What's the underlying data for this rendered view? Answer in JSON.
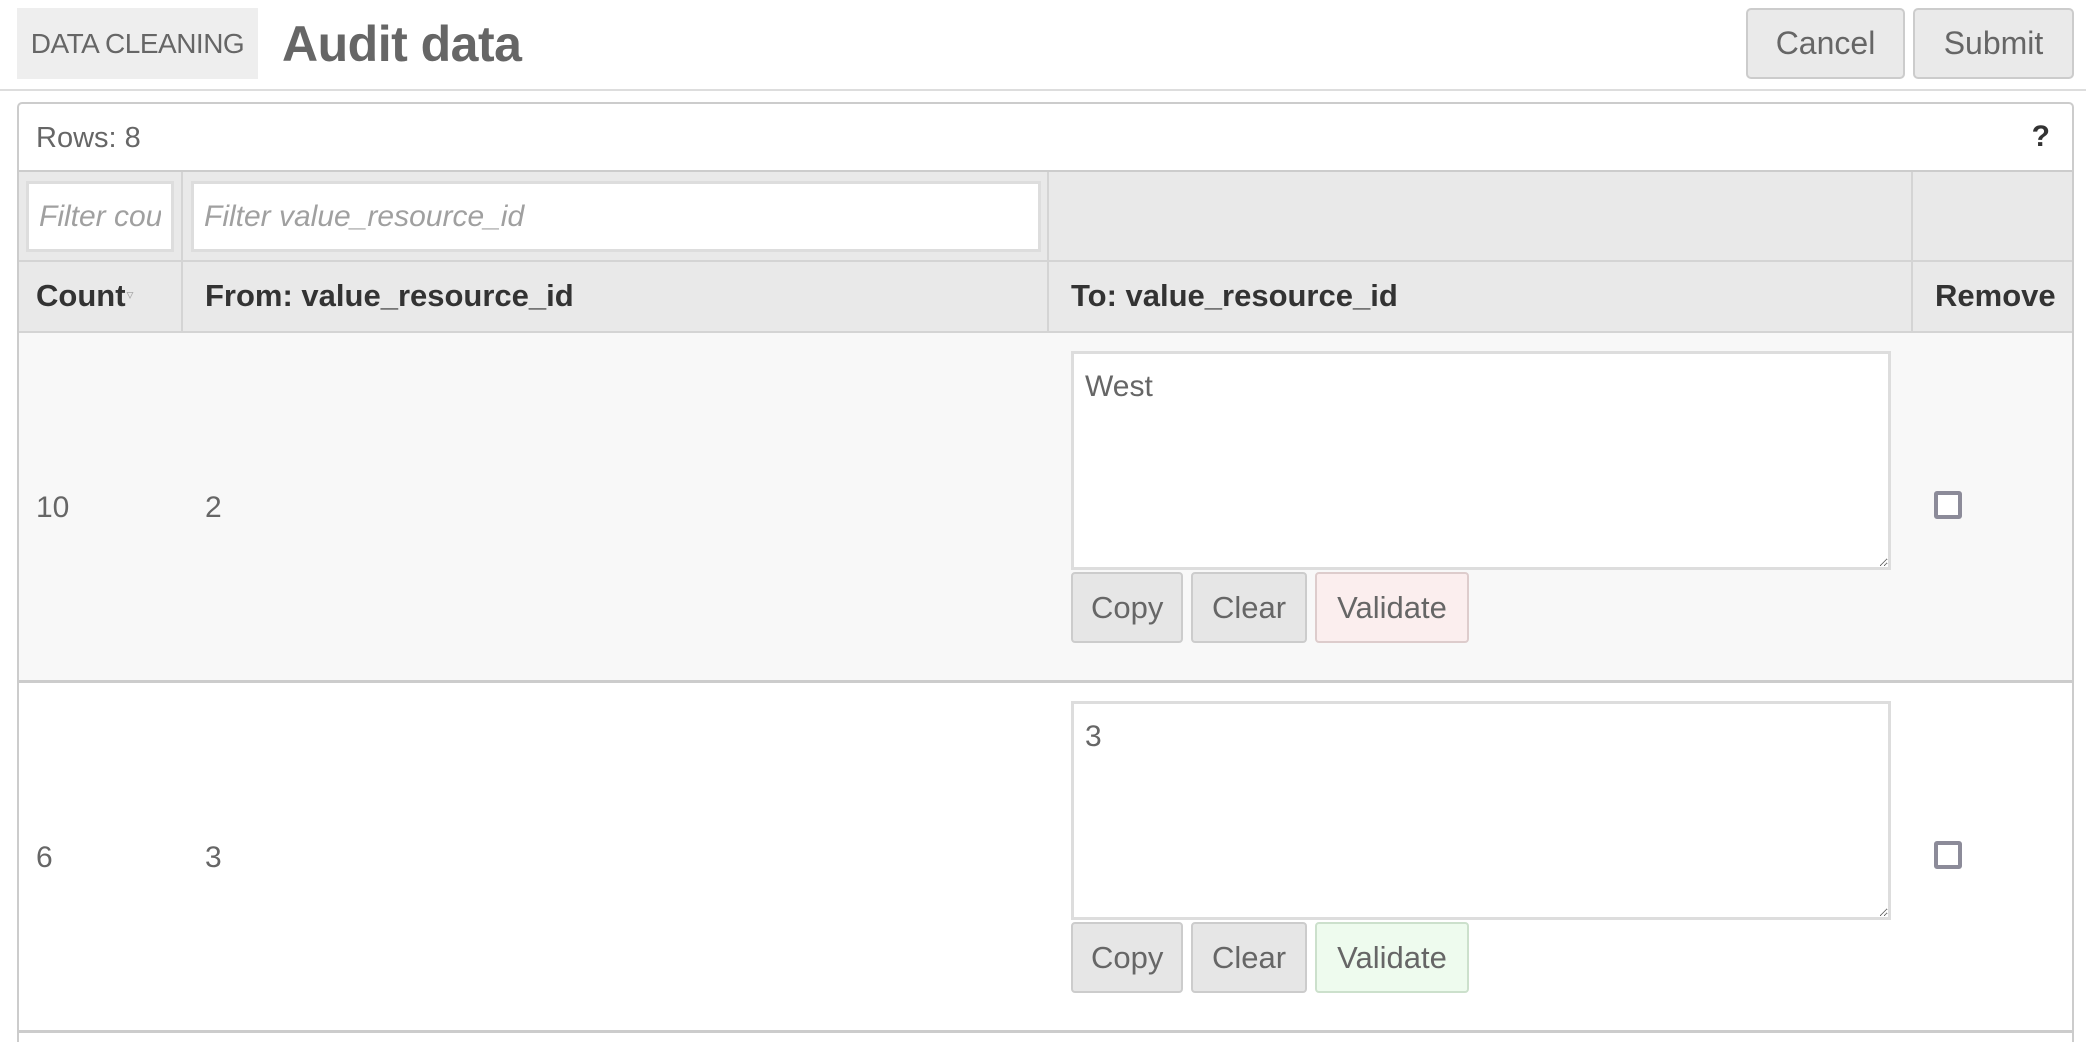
{
  "header": {
    "badge": "DATA CLEANING",
    "title": "Audit data",
    "cancel_label": "Cancel",
    "submit_label": "Submit"
  },
  "panel": {
    "rows_label": "Rows: 8",
    "help_icon": "?"
  },
  "filters": {
    "count_placeholder": "Filter count",
    "from_placeholder": "Filter value_resource_id",
    "count_value": "",
    "from_value": ""
  },
  "columns": {
    "count": "Count",
    "count_sort_icon": "▿",
    "from": "From: value_resource_id",
    "to": "To: value_resource_id",
    "remove": "Remove"
  },
  "rows": [
    {
      "count": "10",
      "from": "2",
      "to": "West",
      "copy_label": "Copy",
      "clear_label": "Clear",
      "validate_label": "Validate",
      "validate_status": "invalid",
      "remove_checked": false
    },
    {
      "count": "6",
      "from": "3",
      "to": "3",
      "copy_label": "Copy",
      "clear_label": "Clear",
      "validate_label": "Validate",
      "validate_status": "valid",
      "remove_checked": false
    }
  ],
  "colors": {
    "validate_invalid_bg": "#fbeeee",
    "validate_valid_bg": "#eefbee",
    "header_bg": "#e9e9e9"
  }
}
